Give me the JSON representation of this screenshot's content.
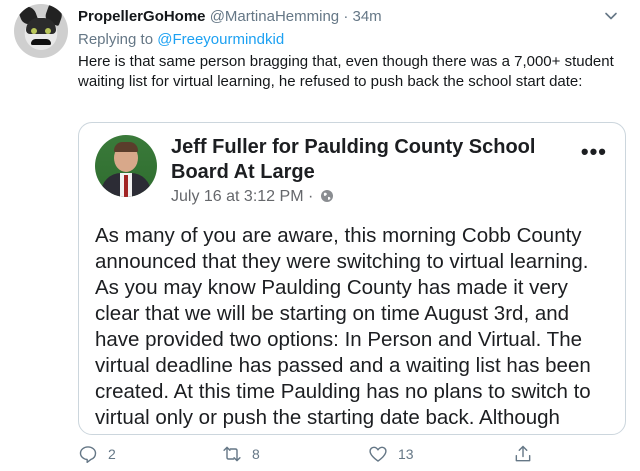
{
  "tweet": {
    "display_name": "PropellerGoHome",
    "handle": "@MartinaHemming",
    "separator": "·",
    "time": "34m",
    "replying_prefix": "Replying to",
    "replying_to": "@Freeyourmindkid",
    "text": "Here is that same person bragging that, even though there was a 7,000+ student waiting list for virtual learning, he refused to push back the school start date:"
  },
  "embedded_post": {
    "author": "Jeff Fuller for Paulding County School Board At Large",
    "date": "July 16 at 3:12 PM ·",
    "more_label": "•••",
    "body": "As many of you are aware, this morning Cobb County announced that they were switching to virtual learning. As you may know Paulding County has made it very clear that we will be starting on time August 3rd, and have provided two options: In Person and Virtual. The virtual deadline has passed and a waiting list has been created. At this time Paulding has no plans to switch to virtual only or push the starting date back. Although"
  },
  "actions": {
    "reply_count": "2",
    "retweet_count": "8",
    "like_count": "13"
  },
  "icons": {
    "chevron": "chevron-down-icon",
    "reply": "reply-icon",
    "retweet": "retweet-icon",
    "like": "heart-icon",
    "share": "share-icon",
    "globe": "globe-icon"
  },
  "colors": {
    "link": "#1da1f2",
    "muted": "#657786",
    "border": "#ccd6dd"
  }
}
